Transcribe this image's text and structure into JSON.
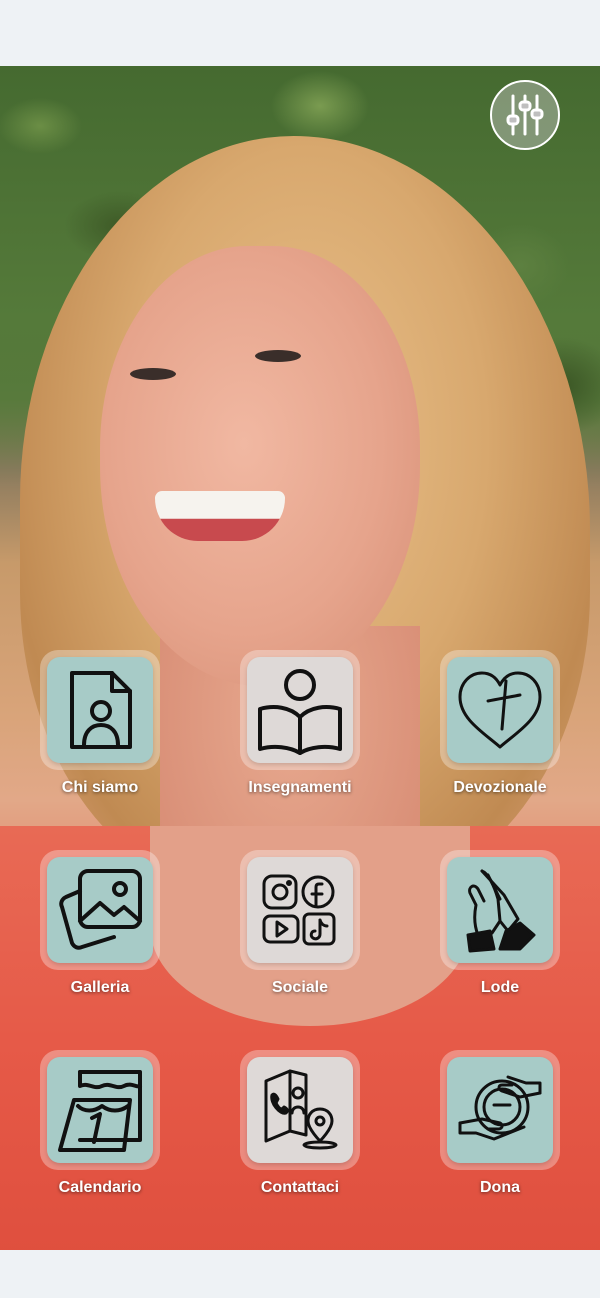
{
  "settings": {
    "icon": "sliders-icon"
  },
  "tiles": [
    {
      "label": "Chi siamo",
      "icon": "profile-document-icon",
      "bg": "#a7cbc7"
    },
    {
      "label": "Insegnamenti",
      "icon": "person-reading-book-icon",
      "bg": "#ded9d7"
    },
    {
      "label": "Devozionale",
      "icon": "heart-cross-icon",
      "bg": "#a7cbc7"
    },
    {
      "label": "Galleria",
      "icon": "photo-gallery-icon",
      "bg": "#a7cbc7"
    },
    {
      "label": "Sociale",
      "icon": "social-media-icon",
      "bg": "#ded9d7"
    },
    {
      "label": "Lode",
      "icon": "praying-hands-icon",
      "bg": "#a7cbc7"
    },
    {
      "label": "Calendario",
      "icon": "calendar-icon",
      "bg": "#a7cbc7"
    },
    {
      "label": "Contattaci",
      "icon": "contact-book-icon",
      "bg": "#ded9d7"
    },
    {
      "label": "Dona",
      "icon": "donation-hands-icon",
      "bg": "#a7cbc7"
    }
  ]
}
